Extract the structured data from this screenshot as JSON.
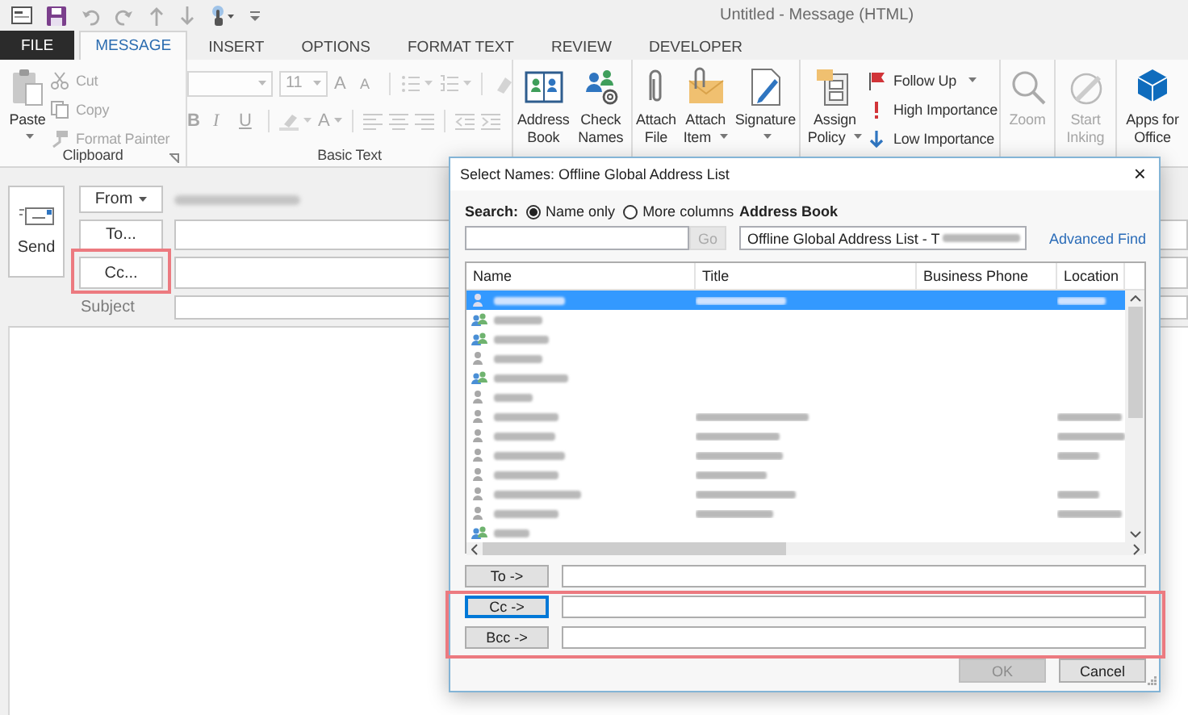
{
  "window": {
    "title": "Untitled - Message (HTML)"
  },
  "tabs": [
    {
      "label": "FILE",
      "kind": "file",
      "selected": false
    },
    {
      "label": "MESSAGE",
      "kind": "tab",
      "selected": true
    },
    {
      "label": "INSERT",
      "kind": "tab",
      "selected": false
    },
    {
      "label": "OPTIONS",
      "kind": "tab",
      "selected": false
    },
    {
      "label": "FORMAT TEXT",
      "kind": "tab",
      "selected": false
    },
    {
      "label": "REVIEW",
      "kind": "tab",
      "selected": false
    },
    {
      "label": "DEVELOPER",
      "kind": "tab",
      "selected": false
    }
  ],
  "ribbon": {
    "groups": [
      {
        "label": "Clipboard",
        "launcher": true,
        "items": [
          {
            "kind": "large",
            "label": "Paste",
            "dropdown": true,
            "disabled": false
          },
          {
            "kind": "stack",
            "items": [
              {
                "label": "Cut",
                "disabled": true
              },
              {
                "label": "Copy",
                "disabled": true
              },
              {
                "label": "Format Painter",
                "disabled": true
              }
            ]
          }
        ]
      },
      {
        "label": "Basic Text",
        "items": [
          {
            "kind": "tools",
            "rows": [
              [
                {
                  "kind": "field",
                  "disabled": true
                },
                {
                  "kind": "field",
                  "value": "11",
                  "disabled": true
                },
                {
                  "kind": "letter",
                  "label": "A",
                  "disabled": true
                },
                {
                  "kind": "letter",
                  "label": "A",
                  "disabled": true
                },
                {
                  "kind": "sep"
                },
                {
                  "kind": "icon",
                  "dropdown": true,
                  "disabled": true
                },
                {
                  "kind": "icon",
                  "dropdown": true,
                  "disabled": true
                },
                {
                  "kind": "sep"
                },
                {
                  "kind": "icon",
                  "disabled": true
                }
              ],
              [
                {
                  "kind": "letter",
                  "label": "B",
                  "disabled": true
                },
                {
                  "kind": "letter",
                  "label": "I",
                  "disabled": true
                },
                {
                  "kind": "letter",
                  "label": "U",
                  "disabled": true
                },
                {
                  "kind": "sep"
                },
                {
                  "kind": "icon",
                  "dropdown": true,
                  "disabled": true
                },
                {
                  "kind": "letter",
                  "label": "A",
                  "dropdown": true,
                  "disabled": true
                },
                {
                  "kind": "sep"
                },
                {
                  "kind": "icon",
                  "disabled": true
                },
                {
                  "kind": "icon",
                  "disabled": true
                },
                {
                  "kind": "icon",
                  "disabled": true
                },
                {
                  "kind": "sep"
                },
                {
                  "kind": "icon",
                  "disabled": true
                },
                {
                  "kind": "icon",
                  "disabled": true
                }
              ]
            ]
          }
        ]
      },
      {
        "items": [
          {
            "kind": "large",
            "label": "Address Book",
            "disabled": false
          },
          {
            "kind": "large",
            "label": "Check Names",
            "disabled": false
          }
        ]
      },
      {
        "items": [
          {
            "kind": "large",
            "label": "Attach File",
            "disabled": false
          },
          {
            "kind": "large",
            "label": "Attach Item",
            "dropdown": true,
            "disabled": false
          },
          {
            "kind": "large",
            "label": "Signature",
            "dropdown": true,
            "disabled": false
          }
        ]
      },
      {
        "items": [
          {
            "kind": "large",
            "label": "Assign Policy",
            "dropdown": true,
            "disabled": false
          },
          {
            "kind": "stack",
            "items": [
              {
                "label": "Follow Up",
                "dropdown": true,
                "disabled": false
              },
              {
                "label": "High Importance",
                "disabled": false
              },
              {
                "label": "Low Importance",
                "disabled": false
              }
            ]
          }
        ]
      },
      {
        "items": [
          {
            "kind": "large",
            "label": "Zoom",
            "disabled": true
          }
        ]
      },
      {
        "items": [
          {
            "kind": "large",
            "label": "Start Inking",
            "disabled": true
          }
        ]
      },
      {
        "items": [
          {
            "kind": "large",
            "label": "Apps for Office",
            "disabled": false
          }
        ]
      }
    ]
  },
  "compose": {
    "send": "Send",
    "from": {
      "label": "From",
      "redacted": true
    },
    "recipients": [
      {
        "label": "To...",
        "highlighted": false
      },
      {
        "label": "Cc...",
        "highlighted": true
      }
    ],
    "subject_label": "Subject"
  },
  "dialog": {
    "title": "Select Names: Offline Global Address List",
    "close": "×",
    "search_label": "Search:",
    "search_modes": [
      {
        "label": "Name only",
        "selected": true
      },
      {
        "label": "More columns",
        "selected": false
      }
    ],
    "go_button": {
      "label": "Go",
      "disabled": true
    },
    "address_book_label": "Address Book",
    "address_book": "Offline Global Address List - T",
    "advanced_find": "Advanced Find",
    "columns": [
      "Name",
      "Title",
      "Business Phone",
      "Location"
    ],
    "contacts": [
      {
        "kind": "user",
        "selected": true,
        "has_title": true,
        "has_location": true
      },
      {
        "kind": "group",
        "selected": false,
        "has_title": false,
        "has_location": false
      },
      {
        "kind": "group",
        "selected": false,
        "has_title": false,
        "has_location": false
      },
      {
        "kind": "user",
        "selected": false,
        "has_title": false,
        "has_location": false
      },
      {
        "kind": "group",
        "selected": false,
        "has_title": false,
        "has_location": false
      },
      {
        "kind": "user",
        "selected": false,
        "has_title": false,
        "has_location": false
      },
      {
        "kind": "user",
        "selected": false,
        "has_title": true,
        "has_location": true
      },
      {
        "kind": "user",
        "selected": false,
        "has_title": true,
        "has_location": true
      },
      {
        "kind": "user",
        "selected": false,
        "has_title": true,
        "has_location": true
      },
      {
        "kind": "user",
        "selected": false,
        "has_title": true,
        "has_location": false
      },
      {
        "kind": "user",
        "selected": false,
        "has_title": true,
        "has_location": true
      },
      {
        "kind": "user",
        "selected": false,
        "has_title": true,
        "has_location": true
      },
      {
        "kind": "group",
        "selected": false,
        "has_title": false,
        "has_location": false
      }
    ],
    "recipient_wells": [
      {
        "label": "To ->",
        "highlighted": false,
        "focused": false
      },
      {
        "label": "Cc ->",
        "highlighted": true,
        "focused": true
      },
      {
        "label": "Bcc ->",
        "highlighted": true,
        "focused": false
      }
    ],
    "buttons": [
      {
        "label": "OK",
        "disabled": true
      },
      {
        "label": "Cancel",
        "disabled": false
      }
    ]
  }
}
